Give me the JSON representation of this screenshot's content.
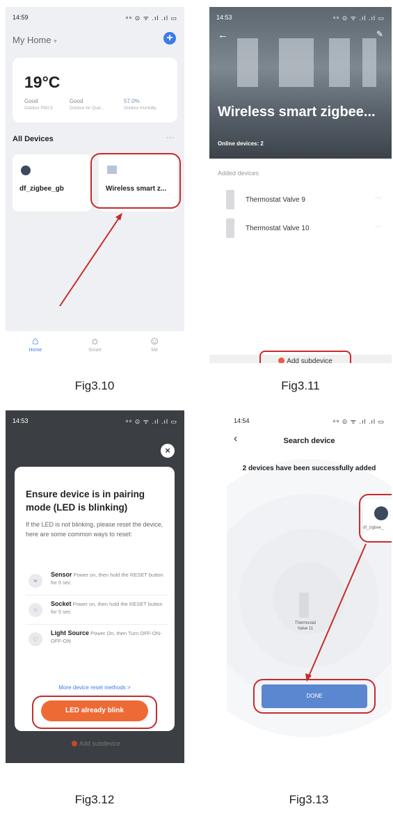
{
  "fig310": {
    "status_time": "14:59",
    "status_icons": "⁸⁸ ⊙ ᯤ .ıl .ıl ▭",
    "home_title": "My Home",
    "home_caret": "▾",
    "add_glyph": "+",
    "temperature": "19°C",
    "weather": [
      {
        "value": "Good",
        "label": "Outdoor PM2.5"
      },
      {
        "value": "Good",
        "label": "Outdoor Air Qual..."
      },
      {
        "value": "57.0%",
        "label": "Outdoor Humidity"
      }
    ],
    "section_title": "All Devices",
    "more": "···",
    "devices": [
      "df_zigbee_gb",
      "Wireless smart z..."
    ],
    "tabs": [
      {
        "icon": "⌂",
        "label": "Home"
      },
      {
        "icon": "☼",
        "label": "Smart"
      },
      {
        "icon": "☺",
        "label": "Me"
      }
    ],
    "caption": "Fig3.10"
  },
  "fig311": {
    "status_time": "14:53",
    "status_icons": "⁸⁸ ⊙ ᯤ .ıl .ıl ▭",
    "back": "←",
    "edit": "✎",
    "hero_title": "Wireless smart zigbee...",
    "online": "Online devices: 2",
    "added_label": "Added devices",
    "devices": [
      "Thermostat Valve 9",
      "Thermostat Valve 10"
    ],
    "row_more": "···",
    "add_subdevice": "Add subdevice",
    "caption": "Fig3.11"
  },
  "fig312": {
    "status_time": "14:53",
    "status_icons": "⁸⁸ ⊙ ᯤ .ıl .ıl ▭",
    "close": "×",
    "dialog_title": "Ensure device is in pairing mode (LED is blinking)",
    "dialog_desc": "If the LED is not blinking, please reset the device, here are some common ways to reset:",
    "methods": [
      {
        "icon": "≈",
        "name": "Sensor",
        "desc": "Power on, then hold the RESET button for 5 sec"
      },
      {
        "icon": "⁘",
        "name": "Socket",
        "desc": "Power on, then hold the RESET button for 5 sec"
      },
      {
        "icon": "♡",
        "name": "Light Source",
        "desc": "Power On, then Turn OFF-ON-OFF-ON"
      }
    ],
    "more_methods": "More device reset methods >",
    "blink_button": "LED already blink",
    "add_subdevice": "Add subdevice",
    "caption": "Fig3.12"
  },
  "fig313": {
    "status_time": "14:54",
    "status_icons": "⁸⁸ ⊙ ᯤ .ıl .ıl ▭",
    "back": "‹",
    "title": "Search device",
    "success": "2 devices have been successfully added",
    "devices": [
      "df_zigbee_",
      "Thermostat Valve 11"
    ],
    "done": "DONE",
    "caption": "Fig3.13"
  },
  "colors": {
    "annotation_red": "#c72b2b",
    "accent_blue": "#3d7be6",
    "button_orange": "#ee6a35",
    "done_blue": "#5b87d0"
  }
}
